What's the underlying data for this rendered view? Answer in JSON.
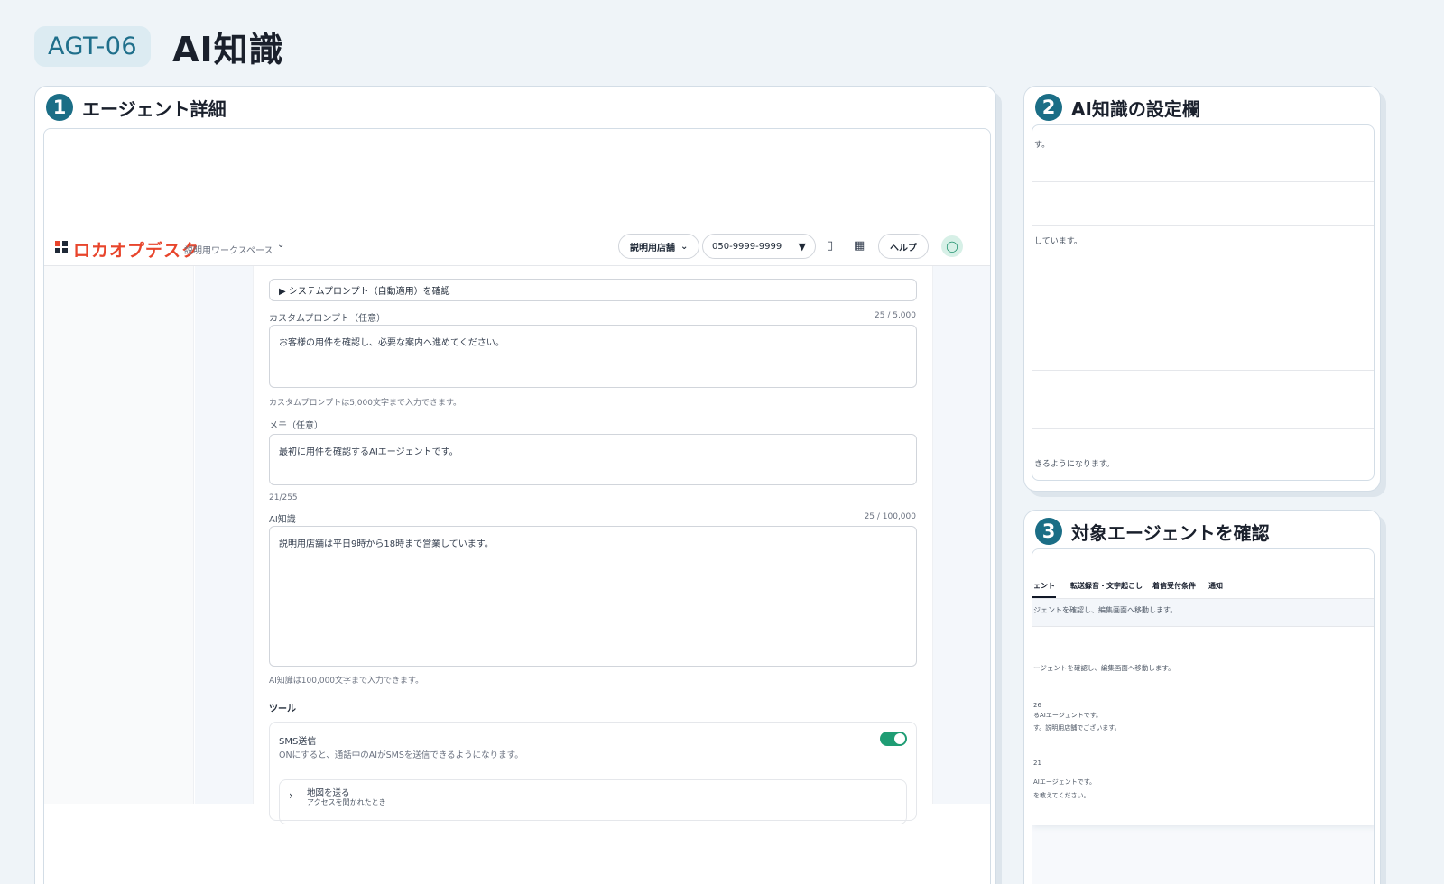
{
  "header": {
    "badge": "AGT-06",
    "title": "AI知識"
  },
  "panel1": {
    "number": "1",
    "title": "エージェント詳細",
    "app": {
      "logo": "ロカオプデスク",
      "workspace": "説明用ワークスペース",
      "store": "説明用店舗",
      "phone": "050-9999-9999",
      "help": "ヘルプ",
      "system_prompt_toggle": "▶ システムプロンプト（自動適用）を確認",
      "custom_prompt_label": "カスタムプロンプト（任意）",
      "custom_prompt_count": "25 / 5,000",
      "custom_prompt_value": "お客様の用件を確認し、必要な案内へ進めてください。",
      "custom_prompt_hint": "カスタムプロンプトは5,000文字まで入力できます。",
      "memo_label": "メモ（任意）",
      "memo_value": "最初に用件を確認するAIエージェントです。",
      "memo_count": "21/255",
      "ai_label": "AI知識",
      "ai_count": "25 / 100,000",
      "ai_value": "説明用店舗は平日9時から18時まで営業しています。",
      "ai_hint": "AI知識は100,000文字まで入力できます。",
      "tools_heading": "ツール",
      "sms_title": "SMS送信",
      "sms_desc": "ONにすると、通話中のAIがSMSを送信できるようになります。",
      "map_title": "地図を送る",
      "map_desc": "アクセスを聞かれたとき"
    }
  },
  "panel2": {
    "number": "2",
    "title": "AI知識の設定欄",
    "line1": "す。",
    "line2": "しています。",
    "line3": "きるようになります。"
  },
  "panel3": {
    "number": "3",
    "title": "対象エージェントを確認",
    "tabs": [
      "ェント",
      "転送録音・文字起こし",
      "着信受付条件",
      "通知"
    ],
    "desc": "ジェントを確認し、編集画面へ移動します。",
    "desc2": "ージェントを確認し、編集画面へ移動します。",
    "row1_id": "26",
    "row1_a": "るAIエージェントです。",
    "row1_b": "す。説明用店舗でございます。",
    "row2_id": "21",
    "row2_a": "AIエージェントです。",
    "row2_b": "を教えてください。"
  }
}
